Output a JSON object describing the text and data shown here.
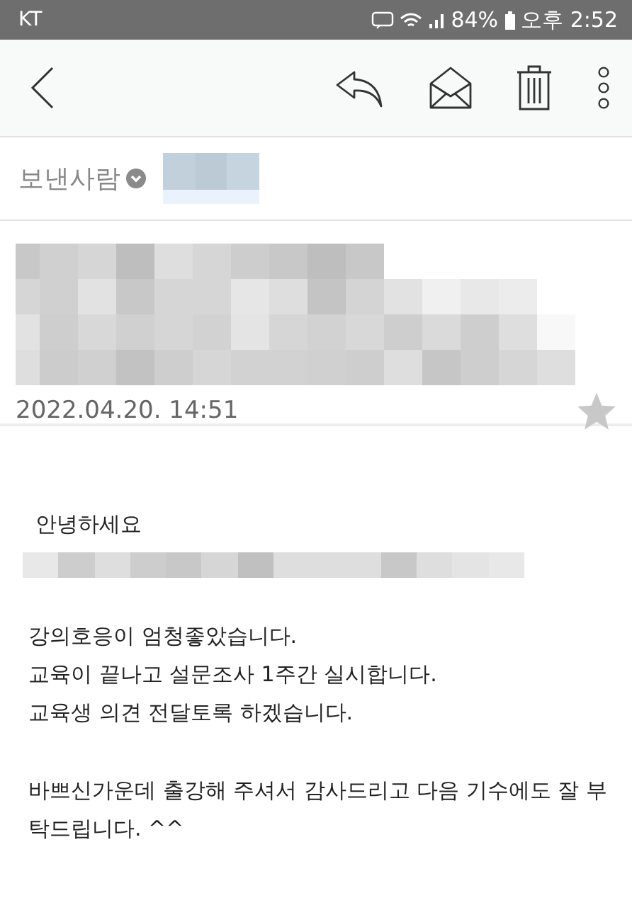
{
  "status_bar": {
    "carrier": "KT",
    "battery": "84%",
    "time": "오후 2:52"
  },
  "sender": {
    "label": "보낸사람"
  },
  "message": {
    "date": "2022.04.20. 14:51",
    "starred": false
  },
  "body": {
    "greeting": "안녕하세요",
    "paragraphs": [
      [
        "강의호응이 엄청좋았습니다.",
        "교육이 끝나고 설문조사 1주간 실시합니다.",
        "교육생 의견 전달토록 하겠습니다."
      ],
      [
        "바쁘신가운데 출강해 주셔서 감사드리고 다음 기수에도 잘 부",
        "탁드립니다. ^^"
      ]
    ]
  }
}
